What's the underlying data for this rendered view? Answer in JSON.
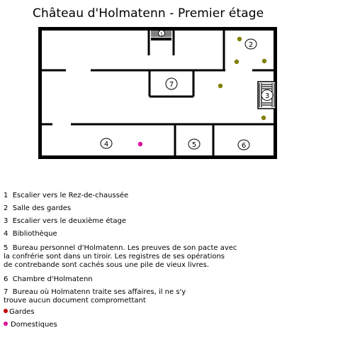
{
  "title": "Château d'Holmatenn - Premier étage",
  "colors": {
    "guard": "#808000",
    "servant": "#e0109a",
    "wall": "#000000"
  },
  "rooms": [
    {
      "number": "1",
      "name": "Escalier vers le Rez-de-chaussée"
    },
    {
      "number": "2",
      "name": "Salle des gardes"
    },
    {
      "number": "3",
      "name": "Escalier vers le deuxième étage"
    },
    {
      "number": "4",
      "name": "Bibliothèque"
    },
    {
      "number": "5",
      "name": "Bureau personnel d'Holmatenn. Les preuves de son pacte avec\nla confrérie sont dans un tiroir. Les registres de ses opérations\nde contrebande sont cachés sous une pile de vieux livres."
    },
    {
      "number": "6",
      "name": "Chambre d'Holmatenn"
    },
    {
      "number": "7",
      "name": "Bureau où Holmatenn traite ses affaires, il ne s'y\ntrouve aucun document compromettant"
    }
  ],
  "legend": {
    "guards": "Gardes",
    "servants": "Domestiques"
  }
}
